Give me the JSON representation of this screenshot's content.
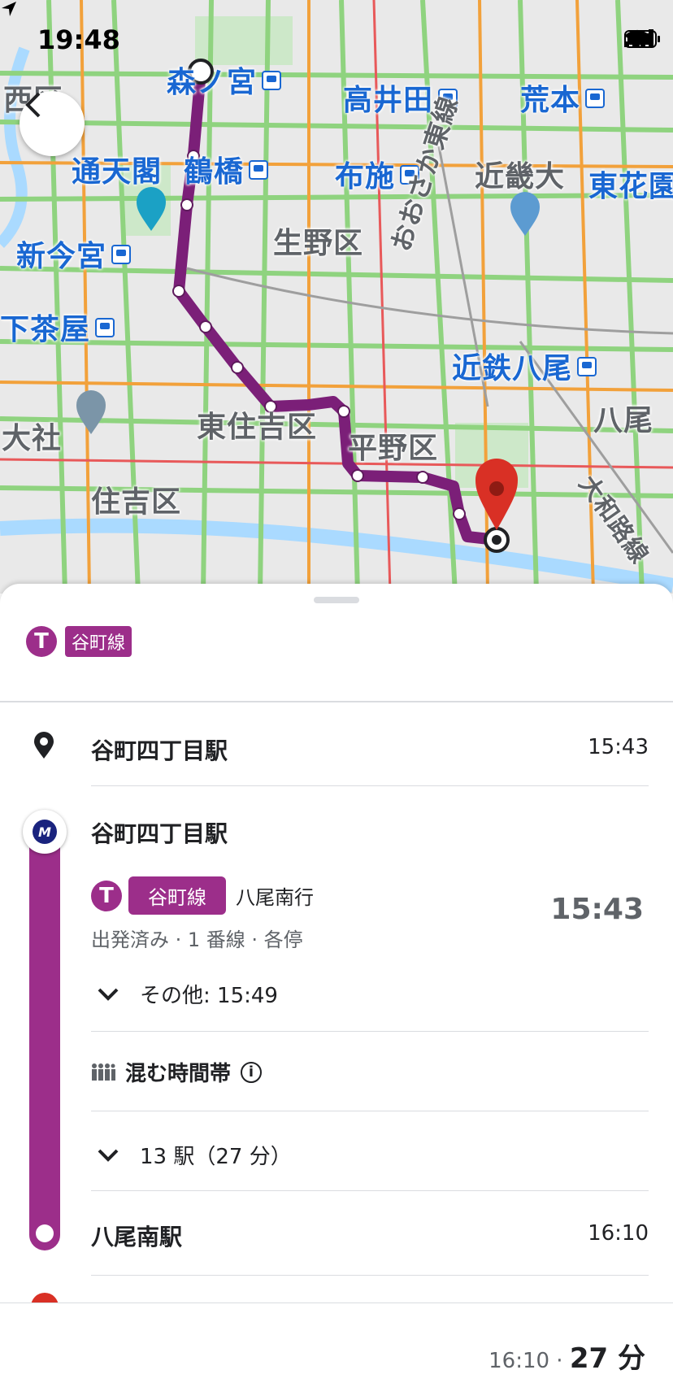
{
  "status_bar": {
    "time": "19:48"
  },
  "map": {
    "labels": [
      {
        "key": "l1",
        "text": "森ノ宮",
        "station": true
      },
      {
        "key": "l2",
        "text": "高井田",
        "station": true
      },
      {
        "key": "l3",
        "text": "荒本",
        "station": true
      },
      {
        "key": "l4",
        "text": "西区",
        "station": false
      },
      {
        "key": "l5",
        "text": "通天閣",
        "station": false
      },
      {
        "key": "l6",
        "text": "鶴橋",
        "station": true
      },
      {
        "key": "l7",
        "text": "布施",
        "station": true
      },
      {
        "key": "l8",
        "text": "近畿大",
        "station": false
      },
      {
        "key": "l9",
        "text": "東花園",
        "station": true
      },
      {
        "key": "l10",
        "text": "新今宮",
        "station": true
      },
      {
        "key": "l11",
        "text": "生野区",
        "station": false
      },
      {
        "key": "l12",
        "text": "下茶屋",
        "station": true
      },
      {
        "key": "l13",
        "text": "おおさか東線",
        "station": false
      },
      {
        "key": "l14",
        "text": "近鉄八尾",
        "station": true
      },
      {
        "key": "l15",
        "text": "大社",
        "station": false
      },
      {
        "key": "l16",
        "text": "東住吉区",
        "station": false
      },
      {
        "key": "l17",
        "text": "平野区",
        "station": false
      },
      {
        "key": "l18",
        "text": "八尾",
        "station": false
      },
      {
        "key": "l19",
        "text": "住吉区",
        "station": false
      },
      {
        "key": "l20",
        "text": "大和路線",
        "station": false
      }
    ]
  },
  "sheet": {
    "line_badge": "T",
    "line_name": "谷町線",
    "origin": {
      "name": "谷町四丁目駅",
      "time": "15:43"
    },
    "board": {
      "station": "谷町四丁目駅",
      "metro_logo": "M",
      "line_badge": "T",
      "line_name": "谷町線",
      "destination": "八尾南行",
      "depart_time": "15:43",
      "meta": "出発済み · 1 番線 · 各停"
    },
    "other": "その他: 15:49",
    "crowd": "混む時間帯",
    "stops": "13 駅（27 分）",
    "arrival": {
      "name": "八尾南駅",
      "time": "16:10"
    }
  },
  "footer": {
    "arrive": "16:10 · ",
    "duration": "27 分"
  },
  "colors": {
    "line": "#9c2e8a",
    "route": "#7b1f78",
    "pin": "#d93025"
  }
}
